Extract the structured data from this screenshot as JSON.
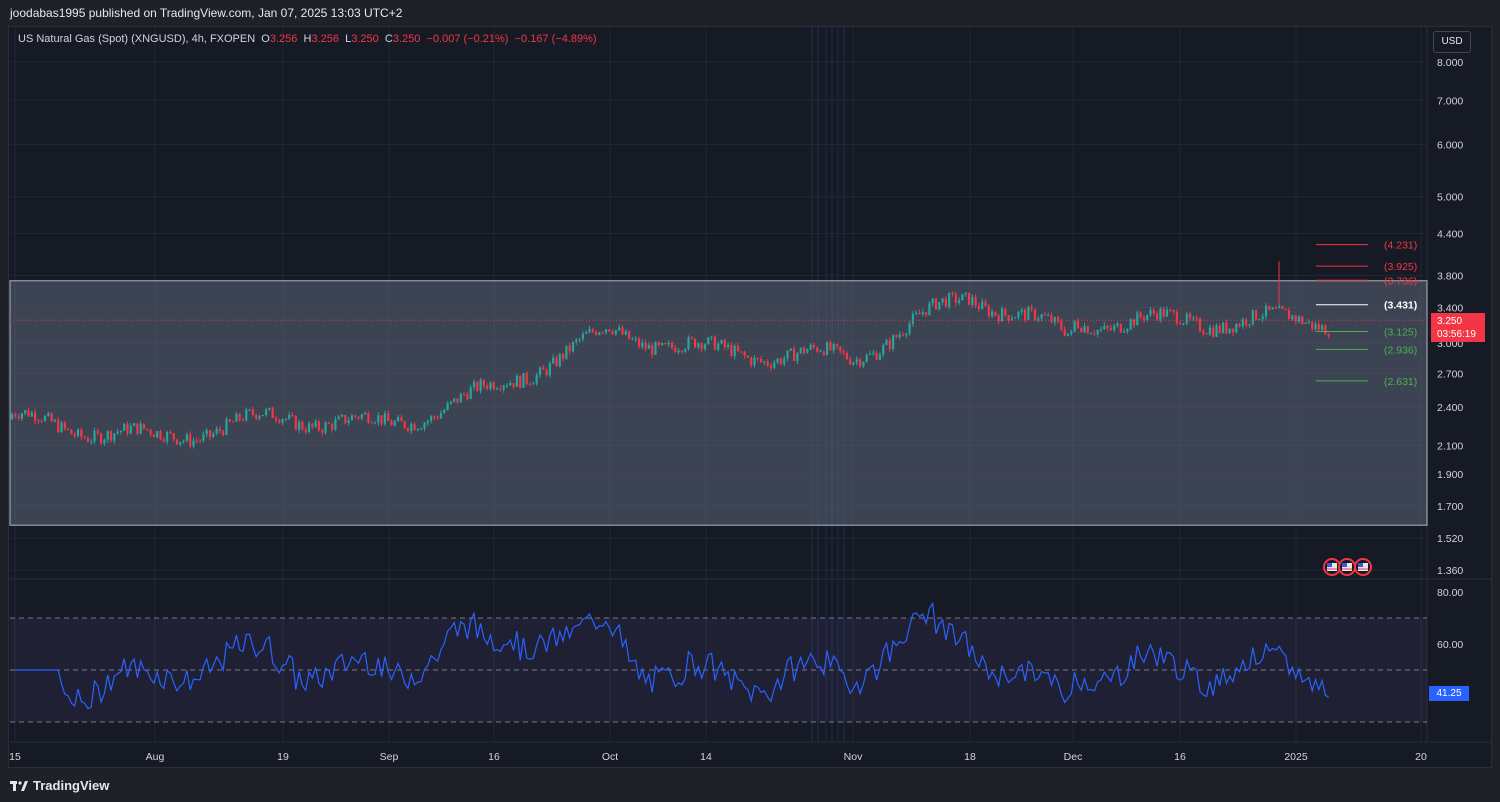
{
  "header": {
    "published_line": "joodabas1995 published on TradingView.com, Jan 07, 2025 13:03 UTC+2"
  },
  "legend": {
    "symbol": "US Natural Gas (Spot) (XNGUSD), 4h, FXOPEN",
    "o_label": "O",
    "o_value": "3.256",
    "h_label": "H",
    "h_value": "3.256",
    "l_label": "L",
    "l_value": "3.250",
    "c_label": "C",
    "c_value": "3.250",
    "change": "−0.007 (−0.21%)",
    "change2": "−0.167 (−4.89%)"
  },
  "currency": "USD",
  "price_badge": {
    "price": "3.250",
    "countdown": "03:56:19"
  },
  "rsi_badge": "41.25",
  "footer": {
    "brand": "TradingView"
  },
  "colors": {
    "up": "#26a69a",
    "down": "#f23645",
    "rsi_line": "#2962ff",
    "fib_red": "#f23645",
    "fib_white": "#ffffff",
    "fib_green": "#4caf50"
  },
  "chart_data": [
    {
      "type": "candlestick",
      "title": "US Natural Gas (Spot) (XNGUSD), 4h, FXOPEN",
      "scale": "log",
      "ylim": [
        1.3,
        9.0
      ],
      "y_ticks": [
        "8.000",
        "7.000",
        "6.000",
        "5.000",
        "4.400",
        "3.800",
        "3.400",
        "3.000",
        "2.700",
        "2.400",
        "2.100",
        "1.900",
        "1.700",
        "1.520",
        "1.360"
      ],
      "x_ticks": [
        "15",
        "Aug",
        "19",
        "Sep",
        "16",
        "Oct",
        "14",
        "Nov",
        "18",
        "Dec",
        "16",
        "2025",
        "20"
      ],
      "close_path": {
        "x": [
          "15",
          "Aug",
          "19",
          "Sep",
          "16",
          "Oct",
          "14",
          "Nov",
          "18",
          "Dec",
          "16",
          "2025"
        ],
        "y": [
          2.3,
          2.15,
          2.32,
          2.25,
          2.55,
          3.12,
          2.92,
          2.85,
          3.55,
          3.05,
          3.18,
          3.25
        ]
      },
      "current_price": 3.25,
      "range_box": {
        "top": 3.73,
        "bottom": 1.59
      },
      "fib_levels": [
        {
          "label": "(4.231)",
          "value": 4.231,
          "color": "red"
        },
        {
          "label": "(3.925)",
          "value": 3.925,
          "color": "red"
        },
        {
          "label": "(3.736)",
          "value": 3.736,
          "color": "red"
        },
        {
          "label": "(3.431)",
          "value": 3.431,
          "color": "white"
        },
        {
          "label": "(3.125)",
          "value": 3.125,
          "color": "green"
        },
        {
          "label": "(2.936)",
          "value": 2.936,
          "color": "green"
        },
        {
          "label": "(2.631)",
          "value": 2.631,
          "color": "green"
        }
      ]
    },
    {
      "type": "line",
      "title": "RSI",
      "ylim": [
        20,
        84
      ],
      "y_ticks": [
        "80.00",
        "60.00"
      ],
      "levels": [
        70,
        50,
        30
      ],
      "current": 41.25
    }
  ]
}
